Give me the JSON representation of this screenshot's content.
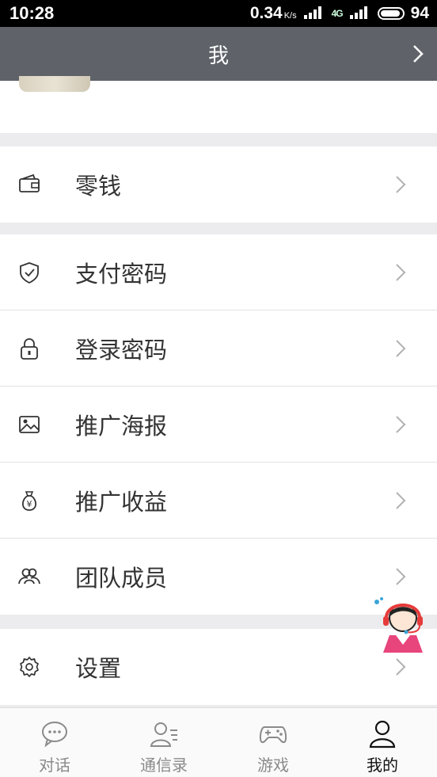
{
  "status_bar": {
    "time": "10:28",
    "speed": "0.34",
    "speed_unit": "K/s",
    "signal_label": "4G",
    "battery": "94"
  },
  "nav": {
    "title": "我"
  },
  "menu_groups": [
    {
      "items": [
        {
          "label": "零钱",
          "icon": "wallet-icon"
        }
      ]
    },
    {
      "items": [
        {
          "label": "支付密码",
          "icon": "shield-check-icon"
        },
        {
          "label": "登录密码",
          "icon": "lock-icon"
        },
        {
          "label": "推广海报",
          "icon": "image-icon"
        },
        {
          "label": "推广收益",
          "icon": "money-bag-icon"
        },
        {
          "label": "团队成员",
          "icon": "team-icon"
        }
      ]
    },
    {
      "items": [
        {
          "label": "设置",
          "icon": "gear-icon"
        }
      ]
    }
  ],
  "tabs": [
    {
      "label": "对话",
      "icon": "chat-icon",
      "active": false
    },
    {
      "label": "通信录",
      "icon": "contacts-icon",
      "active": false
    },
    {
      "label": "游戏",
      "icon": "gamepad-icon",
      "active": false
    },
    {
      "label": "我的",
      "icon": "person-icon",
      "active": true
    }
  ],
  "colors": {
    "nav_bg": "#5f6369",
    "page_bg": "#ececee",
    "active_tab": "#111111",
    "inactive_tab": "#8a8a8a"
  }
}
